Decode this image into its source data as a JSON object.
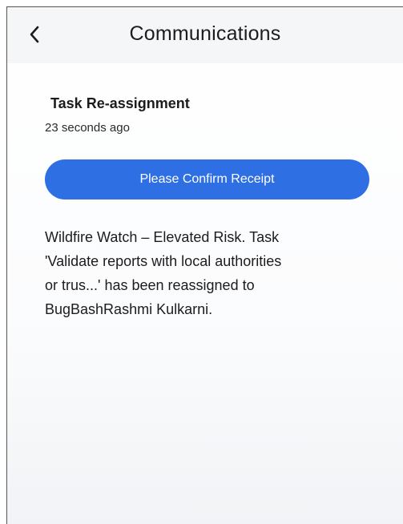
{
  "header": {
    "title": "Communications",
    "back_icon": "chevron-left-icon"
  },
  "notification": {
    "title": "Task Re-assignment",
    "time": "23 seconds ago",
    "confirm_label": "Please Confirm Receipt",
    "message": " Wildfire Watch – Elevated Risk. Task\n'Validate reports with local authorities\nor trus...' has been reassigned to\nBugBashRashmi Kulkarni."
  },
  "colors": {
    "accent": "#2f6fe4",
    "header_bg": "#f5f6f8",
    "text": "#1c1c1e"
  }
}
